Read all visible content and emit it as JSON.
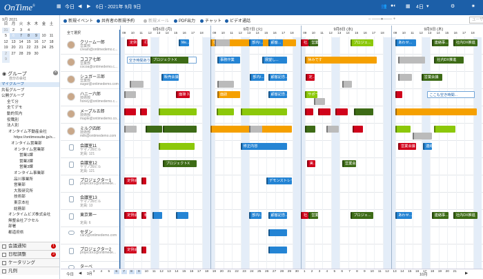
{
  "topbar": {
    "logo": "OnTime",
    "logo_mark": "®",
    "today_label": "今日",
    "range_label": "6日 - 2021年 9月 9日",
    "days_label": "4日",
    "nav_prev": "◀",
    "nav_next": "▶",
    "colors": {
      "bar": "#1c5fa8"
    }
  },
  "calendar": {
    "title": "9月 2021",
    "weekdays": [
      "日",
      "月",
      "火",
      "水",
      "木",
      "金",
      "土"
    ],
    "rows": [
      [
        "29",
        "30",
        "31",
        "1",
        "2",
        "3",
        "4"
      ],
      [
        "5",
        "6",
        "7",
        "8",
        "9",
        "10",
        "11"
      ],
      [
        "12",
        "13",
        "14",
        "15",
        "16",
        "17",
        "18"
      ],
      [
        "19",
        "20",
        "21",
        "22",
        "23",
        "24",
        "25"
      ],
      [
        "26",
        "27",
        "28",
        "29",
        "30",
        "1",
        "2"
      ],
      [
        "3",
        "4",
        "5",
        "6",
        "7",
        "8",
        "9"
      ]
    ]
  },
  "groups": {
    "title": "グループ",
    "subtitle": "自分の会社",
    "close": "×",
    "tree": [
      "マイグループ",
      "共有グループ",
      "公開グループ",
      "全て分",
      "全てデモ",
      "動的気内",
      "役職別",
      "法人別",
      "オンタイム不動産会社",
      "https://ontimesuite.jp/s...",
      "オンタイム営業部",
      "オンタイム営業部",
      "営業1課",
      "営業2課",
      "営業3課",
      "オンタイム事業部",
      "品川事業所",
      "営業部",
      "大阪研究所",
      "技術部",
      "東京本社",
      "総務部",
      "オンタイムビズ株式会社",
      "無整会社アクセル",
      "部署",
      "都道府県"
    ]
  },
  "sidebar_bottom": [
    {
      "label": "会議通知",
      "badge": "1"
    },
    {
      "label": "日程調整",
      "badge": "3"
    },
    {
      "label": "ケータリング",
      "badge": ""
    },
    {
      "label": "凡例",
      "badge": ""
    }
  ],
  "toolbar": {
    "items": [
      "新規イベント",
      "共有者の新規予約",
      "新規メール",
      "PDF出力",
      "チャット",
      "ビデオ通話"
    ],
    "search_placeholder": "ユーザーを検索"
  },
  "schedule": {
    "all_select": "全て選択",
    "days": [
      "9月6日 (月)",
      "9月7日 (火)",
      "9月8日 (水)",
      "9月9日 (木)"
    ],
    "hours": [
      "09",
      "10",
      "11",
      "12",
      "13",
      "14",
      "15",
      "16",
      "17",
      "18"
    ],
    "rows": [
      {
        "name": "クリーム一郎",
        "sub1": "営業部",
        "sub2": "cream@ontimedemo.c...",
        "kind": "person"
      },
      {
        "name": "ココア七郎",
        "sub1": "営業部",
        "sub2": "cocoa@ontimedemo.c...",
        "kind": "person"
      },
      {
        "name": "シュガー三郎",
        "sub1": "営業部",
        "sub2": "sugar@ontimedemo.com",
        "kind": "person"
      },
      {
        "name": "ハニー六郎",
        "sub1": "技術部",
        "sub2": "honey@ontimedemo.c...",
        "kind": "person"
      },
      {
        "name": "メープル五郎",
        "sub1": "技術部",
        "sub2": "maple@ontimedemo.co...",
        "kind": "person"
      },
      {
        "name": "ミルク四郎",
        "sub1": "技術部",
        "sub2": "milk@ontimedemo.com",
        "kind": "person"
      },
      {
        "name": "会議室11",
        "sub1": "ヤマノ26ビル",
        "sub2": "定員: 121",
        "kind": "room"
      },
      {
        "name": "会議室12",
        "sub1": "ヤマノ26ビル",
        "sub2": "定員: 121",
        "kind": "room"
      },
      {
        "name": "プロジェクター1",
        "sub1": "projector1@ontimede...",
        "sub2": "",
        "kind": "room"
      },
      {
        "name": "会議室13",
        "sub1": "ヤマノ26ビル",
        "sub2": "定員: 13",
        "kind": "room"
      },
      {
        "name": "東京第一",
        "sub1": "",
        "sub2": "定員: 6",
        "kind": "room"
      },
      {
        "name": "セダン",
        "sub1": "car2@ontimedemo.com",
        "sub2": "",
        "kind": "car"
      },
      {
        "name": "プロジェクター2",
        "sub1": "projector2@ontimede...",
        "sub2": "",
        "kind": "room"
      },
      {
        "name": "ターベ",
        "sub1": "",
        "sub2": "",
        "kind": "car"
      }
    ],
    "events": [
      {
        "row": 0,
        "day": 0,
        "s": 9.3,
        "e": 10.6,
        "c": "red",
        "t": "定例会..."
      },
      {
        "row": 0,
        "day": 0,
        "s": 11.0,
        "e": 11.8,
        "c": "red",
        "t": "打..."
      },
      {
        "row": 0,
        "day": 0,
        "s": 15.3,
        "e": 16.6,
        "c": "blue",
        "t": "Me..."
      },
      {
        "row": 0,
        "day": 1,
        "s": 8.4,
        "e": 18.5,
        "c": "orange",
        "t": "休みです"
      },
      {
        "row": 0,
        "day": 1,
        "s": 9.0,
        "e": 10.8,
        "c": "gray",
        "t": ""
      },
      {
        "row": 0,
        "day": 2,
        "s": 8.5,
        "e": 9.5,
        "c": "red",
        "t": "社..."
      },
      {
        "row": 0,
        "day": 2,
        "s": 14.3,
        "e": 17.0,
        "c": "lime",
        "t": "プロジェ..."
      },
      {
        "row": 0,
        "day": 3,
        "s": 9.0,
        "e": 11.5,
        "c": "blue",
        "t": "あわせ..."
      },
      {
        "row": 0,
        "day": 3,
        "s": 13.2,
        "e": 15.2,
        "c": "green",
        "t": "連絡事..."
      },
      {
        "row": 0,
        "day": 3,
        "s": 15.7,
        "e": 18.6,
        "c": "green",
        "t": "社内DX推進"
      },
      {
        "row": 0,
        "day": 1,
        "s": 13.0,
        "e": 14.7,
        "c": "blue",
        "t": "部内/..."
      },
      {
        "row": 0,
        "day": 1,
        "s": 15.2,
        "e": 17.0,
        "c": "blue",
        "t": "顧客..."
      },
      {
        "row": 0,
        "day": 2,
        "s": 9.4,
        "e": 10.6,
        "c": "green",
        "t": "営業..."
      },
      {
        "row": 1,
        "day": 0,
        "s": 9.3,
        "e": 17.5,
        "c": "memo",
        "t": "空き時間あり、時点の予定を可能..."
      },
      {
        "row": 1,
        "day": 0,
        "s": 13.5,
        "e": 15.0,
        "c": "gray",
        "t": "社内会議"
      },
      {
        "row": 1,
        "day": 1,
        "s": 9.3,
        "e": 12.0,
        "c": "blue",
        "t": "事務作業"
      },
      {
        "row": 1,
        "day": 1,
        "s": 14.5,
        "e": 17.5,
        "c": "blue",
        "t": "展望し..."
      },
      {
        "row": 1,
        "day": 2,
        "s": 9.0,
        "e": 17.4,
        "c": "orange",
        "t": "休みです"
      },
      {
        "row": 1,
        "day": 3,
        "s": 9.3,
        "e": 12.5,
        "c": "gray",
        "t": ""
      },
      {
        "row": 1,
        "day": 3,
        "s": 13.5,
        "e": 17.0,
        "c": "green",
        "t": "社内DX推進"
      },
      {
        "row": 1,
        "day": 0,
        "s": 12.0,
        "e": 16.5,
        "c": "green",
        "t": "プロジェクトX"
      },
      {
        "row": 2,
        "day": 0,
        "s": 9.6,
        "e": 11.3,
        "c": "gray",
        "t": ""
      },
      {
        "row": 2,
        "day": 0,
        "s": 13.3,
        "e": 15.4,
        "c": "blue",
        "t": "販売会議..."
      },
      {
        "row": 2,
        "day": 1,
        "s": 9.3,
        "e": 11.3,
        "c": "gray",
        "t": ""
      },
      {
        "row": 2,
        "day": 1,
        "s": 13.1,
        "e": 14.8,
        "c": "blue",
        "t": "部内/..."
      },
      {
        "row": 2,
        "day": 1,
        "s": 15.2,
        "e": 17.5,
        "c": "blue",
        "t": "顧客記念..."
      },
      {
        "row": 2,
        "day": 2,
        "s": 9.1,
        "e": 10.2,
        "c": "red",
        "t": "定..."
      },
      {
        "row": 2,
        "day": 2,
        "s": 13.3,
        "e": 14.5,
        "c": "gray",
        "t": ""
      },
      {
        "row": 2,
        "day": 3,
        "s": 9.3,
        "e": 11.0,
        "c": "gray",
        "t": ""
      },
      {
        "row": 2,
        "day": 3,
        "s": 12.0,
        "e": 14.5,
        "c": "green",
        "t": "営業会議"
      },
      {
        "row": 3,
        "day": 0,
        "s": 9.0,
        "e": 10.4,
        "c": "gray",
        "t": ""
      },
      {
        "row": 3,
        "day": 0,
        "s": 15.0,
        "e": 16.7,
        "c": "red",
        "t": "面接 3..."
      },
      {
        "row": 3,
        "day": 1,
        "s": 9.3,
        "e": 12.0,
        "c": "orange",
        "t": "面談"
      },
      {
        "row": 3,
        "day": 1,
        "s": 15.2,
        "e": 17.5,
        "c": "blue",
        "t": "顧客記念..."
      },
      {
        "row": 3,
        "day": 2,
        "s": 9.0,
        "e": 10.5,
        "c": "lime",
        "t": "サポート..."
      },
      {
        "row": 3,
        "day": 2,
        "s": 10.0,
        "e": 11.4,
        "c": "gray",
        "t": ""
      },
      {
        "row": 3,
        "day": 3,
        "s": 12.7,
        "e": 18.3,
        "c": "memo",
        "t": "ここも空き時間..."
      },
      {
        "row": 3,
        "day": 3,
        "s": 9.0,
        "e": 9.9,
        "c": "red",
        "t": ""
      },
      {
        "row": 4,
        "day": 0,
        "s": 9.0,
        "e": 10.4,
        "c": "red",
        "t": ""
      },
      {
        "row": 4,
        "day": 0,
        "s": 10.8,
        "e": 11.7,
        "c": "red",
        "t": ""
      },
      {
        "row": 4,
        "day": 0,
        "s": 13.0,
        "e": 17.5,
        "c": "lime",
        "t": ""
      },
      {
        "row": 4,
        "day": 1,
        "s": 9.2,
        "e": 11.3,
        "c": "lime",
        "t": ""
      },
      {
        "row": 4,
        "day": 1,
        "s": 12.0,
        "e": 17.5,
        "c": "lime",
        "t": ""
      },
      {
        "row": 4,
        "day": 2,
        "s": 9.0,
        "e": 10.0,
        "c": "red",
        "t": ""
      },
      {
        "row": 4,
        "day": 2,
        "s": 10.5,
        "e": 12.0,
        "c": "red",
        "t": ""
      },
      {
        "row": 4,
        "day": 2,
        "s": 12.5,
        "e": 14.0,
        "c": "red",
        "t": ""
      },
      {
        "row": 4,
        "day": 2,
        "s": 14.7,
        "e": 17.0,
        "c": "green",
        "t": ""
      },
      {
        "row": 4,
        "day": 3,
        "s": 9.0,
        "e": 18.5,
        "c": "orange",
        "t": ""
      },
      {
        "row": 5,
        "day": 0,
        "s": 9.0,
        "e": 10.5,
        "c": "gray",
        "t": ""
      },
      {
        "row": 5,
        "day": 0,
        "s": 11.5,
        "e": 13.5,
        "c": "green",
        "t": ""
      },
      {
        "row": 5,
        "day": 0,
        "s": 13.5,
        "e": 17.5,
        "c": "green",
        "t": ""
      },
      {
        "row": 5,
        "day": 1,
        "s": 8.5,
        "e": 18.0,
        "c": "orange",
        "t": ""
      },
      {
        "row": 5,
        "day": 1,
        "s": 13.0,
        "e": 14.6,
        "c": "gray",
        "t": ""
      },
      {
        "row": 5,
        "day": 2,
        "s": 9.0,
        "e": 10.3,
        "c": "green",
        "t": ""
      },
      {
        "row": 5,
        "day": 2,
        "s": 11.5,
        "e": 13.0,
        "c": "gray",
        "t": ""
      },
      {
        "row": 5,
        "day": 2,
        "s": 14.5,
        "e": 15.8,
        "c": "red",
        "t": ""
      },
      {
        "row": 5,
        "day": 3,
        "s": 9.0,
        "e": 10.8,
        "c": "lime",
        "t": ""
      },
      {
        "row": 5,
        "day": 3,
        "s": 11.0,
        "e": 13.3,
        "c": "gray",
        "t": ""
      },
      {
        "row": 5,
        "day": 3,
        "s": 13.5,
        "e": 16.0,
        "c": "lime",
        "t": ""
      },
      {
        "row": 6,
        "day": 0,
        "s": 13.0,
        "e": 17.2,
        "c": "lime",
        "t": ""
      },
      {
        "row": 6,
        "day": 1,
        "s": 12.0,
        "e": 17.5,
        "c": "blue",
        "t": "修正内容"
      },
      {
        "row": 6,
        "day": 3,
        "s": 9.3,
        "e": 11.5,
        "c": "red",
        "t": "営業会議"
      },
      {
        "row": 6,
        "day": 3,
        "s": 12.2,
        "e": 13.3,
        "c": "blue",
        "t": "連絡"
      },
      {
        "row": 7,
        "day": 0,
        "s": 13.5,
        "e": 17.5,
        "c": "green",
        "t": "プロジェクトX"
      },
      {
        "row": 7,
        "day": 2,
        "s": 9.2,
        "e": 10.3,
        "c": "red",
        "t": "実..."
      },
      {
        "row": 7,
        "day": 2,
        "s": 13.3,
        "e": 15.0,
        "c": "green",
        "t": "営業会議"
      },
      {
        "row": 8,
        "day": 0,
        "s": 9.0,
        "e": 10.5,
        "c": "red",
        "t": "定例会..."
      },
      {
        "row": 8,
        "day": 0,
        "s": 11.0,
        "e": 11.6,
        "c": "red",
        "t": ""
      },
      {
        "row": 8,
        "day": 1,
        "s": 15.0,
        "e": 18.0,
        "c": "blue",
        "t": "デモンストレー..."
      },
      {
        "row": 10,
        "day": 0,
        "s": 9.0,
        "e": 10.5,
        "c": "red",
        "t": "定例会..."
      },
      {
        "row": 10,
        "day": 0,
        "s": 11.0,
        "e": 11.6,
        "c": "red",
        "t": "朝..."
      },
      {
        "row": 10,
        "day": 0,
        "s": 12.3,
        "e": 13.5,
        "c": "blue",
        "t": ""
      },
      {
        "row": 10,
        "day": 0,
        "s": 15.0,
        "e": 16.5,
        "c": "blue",
        "t": ""
      },
      {
        "row": 10,
        "day": 1,
        "s": 13.0,
        "e": 14.5,
        "c": "blue",
        "t": "部内/..."
      },
      {
        "row": 10,
        "day": 1,
        "s": 15.2,
        "e": 17.5,
        "c": "blue",
        "t": "顧客記念..."
      },
      {
        "row": 10,
        "day": 2,
        "s": 8.5,
        "e": 9.5,
        "c": "red",
        "t": "社..."
      },
      {
        "row": 10,
        "day": 2,
        "s": 14.3,
        "e": 17.0,
        "c": "green",
        "t": "プロジェ..."
      },
      {
        "row": 10,
        "day": 3,
        "s": 9.0,
        "e": 11.0,
        "c": "blue",
        "t": "あわせ..."
      },
      {
        "row": 10,
        "day": 3,
        "s": 13.2,
        "e": 15.2,
        "c": "green",
        "t": "連絡事..."
      },
      {
        "row": 10,
        "day": 3,
        "s": 15.7,
        "e": 18.6,
        "c": "green",
        "t": "社内DX推進"
      },
      {
        "row": 10,
        "day": 2,
        "s": 9.4,
        "e": 10.6,
        "c": "green",
        "t": "営業..."
      },
      {
        "row": 11,
        "day": 1,
        "s": 15.2,
        "e": 17.5,
        "c": "blue",
        "t": ""
      },
      {
        "row": 12,
        "day": 0,
        "s": 9.0,
        "e": 10.5,
        "c": "red",
        "t": "定例会..."
      },
      {
        "row": 12,
        "day": 0,
        "s": 11.0,
        "e": 11.6,
        "c": "red",
        "t": ""
      },
      {
        "row": 12,
        "day": 1,
        "s": 15.2,
        "e": 17.5,
        "c": "blue",
        "t": ""
      }
    ]
  },
  "bottombar": {
    "today": "今日",
    "month1": "9月",
    "month2": "10月",
    "days": [
      "3",
      "4",
      "5",
      "6",
      "7",
      "8",
      "9",
      "10",
      "11",
      "12",
      "13",
      "14",
      "15",
      "16",
      "17",
      "18",
      "19",
      "20",
      "21",
      "22",
      "23",
      "24",
      "25",
      "26",
      "27",
      "28",
      "29",
      "30",
      "1",
      "2",
      "3",
      "4",
      "5",
      "6",
      "7",
      "8",
      "9",
      "10",
      "11",
      "12",
      "13",
      "14",
      "15",
      "16",
      "17",
      "18",
      "19",
      "20",
      "21"
    ]
  }
}
